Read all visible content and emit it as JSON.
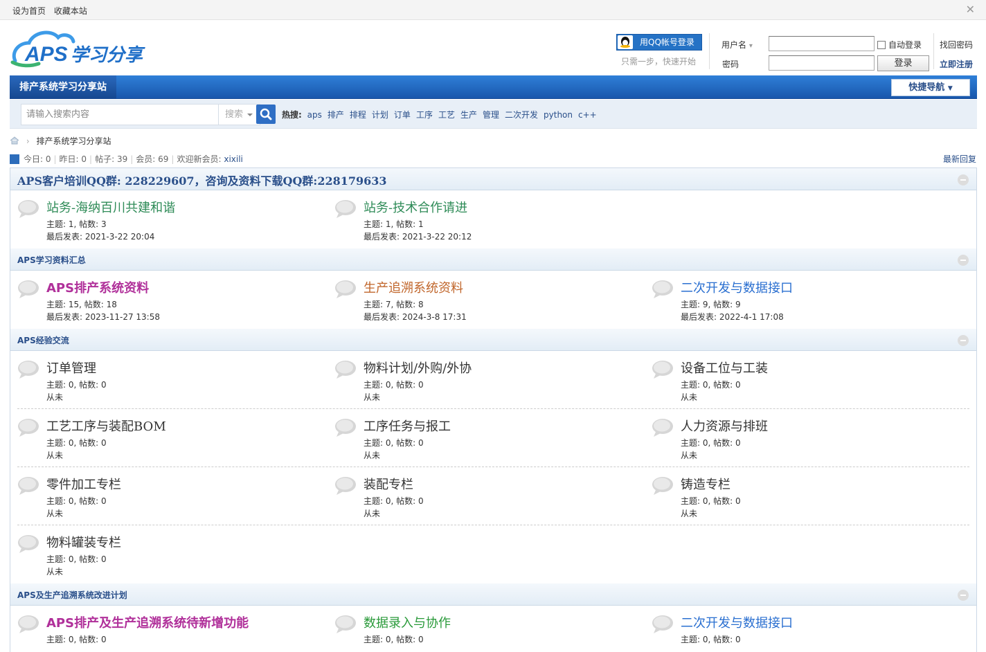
{
  "topbar": {
    "set_home": "设为首页",
    "bookmark": "收藏本站"
  },
  "header": {
    "logo_text": "APS学习分享",
    "qq_login": "用QQ帐号登录",
    "qq_sub": "只需一步，快速开始",
    "username_label": "用户名",
    "password_label": "密码",
    "auto_login": "自动登录",
    "login_button": "登录",
    "find_password": "找回密码",
    "register": "立即注册"
  },
  "nav": {
    "current": "排产系统学习分享站",
    "quick_nav": "快捷导航"
  },
  "search": {
    "placeholder": "请输入搜索内容",
    "type": "搜索",
    "hot_label": "热搜:",
    "hot": [
      "aps",
      "排产",
      "排程",
      "计划",
      "订单",
      "工序",
      "工艺",
      "生产",
      "管理",
      "二次开发",
      "python",
      "c++"
    ]
  },
  "breadcrumb": {
    "current": "排产系统学习分享站"
  },
  "stats": {
    "today": "今日: 0",
    "yesterday": "昨日: 0",
    "posts": "帖子: 39",
    "members": "会员: 69",
    "welcome": "欢迎新会员:",
    "newest": "xixili",
    "latest_reply": "最新回复"
  },
  "categories": [
    {
      "title": "APS客户培训QQ群: 228229607，咨询及资料下载QQ群:228179633",
      "rows": [
        [
          {
            "name": "站务-海纳百川共建和谐",
            "color": "#2e8b57",
            "stats": "主题: 1, 帖数: 3",
            "last": "最后发表: 2021-3-22 20:04"
          },
          {
            "name": "站务-技术合作请进",
            "color": "#2e8b57",
            "stats": "主题: 1, 帖数: 1",
            "last": "最后发表: 2021-3-22 20:12"
          }
        ]
      ]
    },
    {
      "title": "APS学习资料汇总",
      "rows": [
        [
          {
            "name": "APS排产系统资料",
            "color": "#b0309a",
            "bold": true,
            "stats": "主题: 15, 帖数: 18",
            "last": "最后发表: 2023-11-27 13:58"
          },
          {
            "name": "生产追溯系统资料",
            "color": "#c0652a",
            "stats": "主题: 7, 帖数: 8",
            "last": "最后发表: 2024-3-8 17:31"
          },
          {
            "name": "二次开发与数据接口",
            "color": "#2a6fd0",
            "stats": "主题: 9, 帖数: 9",
            "last": "最后发表: 2022-4-1 17:08"
          }
        ]
      ]
    },
    {
      "title": "APS经验交流",
      "rows": [
        [
          {
            "name": "订单管理",
            "color": "#333333",
            "stats": "主题: 0, 帖数: 0",
            "last": "从未"
          },
          {
            "name": "物料计划/外购/外协",
            "color": "#333333",
            "stats": "主题: 0, 帖数: 0",
            "last": "从未"
          },
          {
            "name": "设备工位与工装",
            "color": "#333333",
            "stats": "主题: 0, 帖数: 0",
            "last": "从未"
          }
        ],
        [
          {
            "name": "工艺工序与装配BOM",
            "color": "#333333",
            "stats": "主题: 0, 帖数: 0",
            "last": "从未"
          },
          {
            "name": "工序任务与报工",
            "color": "#333333",
            "stats": "主题: 0, 帖数: 0",
            "last": "从未"
          },
          {
            "name": "人力资源与排班",
            "color": "#333333",
            "stats": "主题: 0, 帖数: 0",
            "last": "从未"
          }
        ],
        [
          {
            "name": "零件加工专栏",
            "color": "#333333",
            "stats": "主题: 0, 帖数: 0",
            "last": "从未"
          },
          {
            "name": "装配专栏",
            "color": "#333333",
            "stats": "主题: 0, 帖数: 0",
            "last": "从未"
          },
          {
            "name": "铸造专栏",
            "color": "#333333",
            "stats": "主题: 0, 帖数: 0",
            "last": "从未"
          }
        ],
        [
          {
            "name": "物料罐装专栏",
            "color": "#333333",
            "stats": "主题: 0, 帖数: 0",
            "last": "从未"
          }
        ]
      ]
    },
    {
      "title": "APS及生产追溯系统改进计划",
      "rows": [
        [
          {
            "name": "APS排产及生产追溯系统待新增功能",
            "color": "#b0309a",
            "bold": true,
            "stats": "主题: 0, 帖数: 0",
            "last": ""
          },
          {
            "name": "数据录入与协作",
            "color": "#2a9a3a",
            "stats": "主题: 0, 帖数: 0",
            "last": ""
          },
          {
            "name": "二次开发与数据接口",
            "color": "#2a6fd0",
            "stats": "主题: 0, 帖数: 0",
            "last": ""
          }
        ]
      ]
    }
  ]
}
